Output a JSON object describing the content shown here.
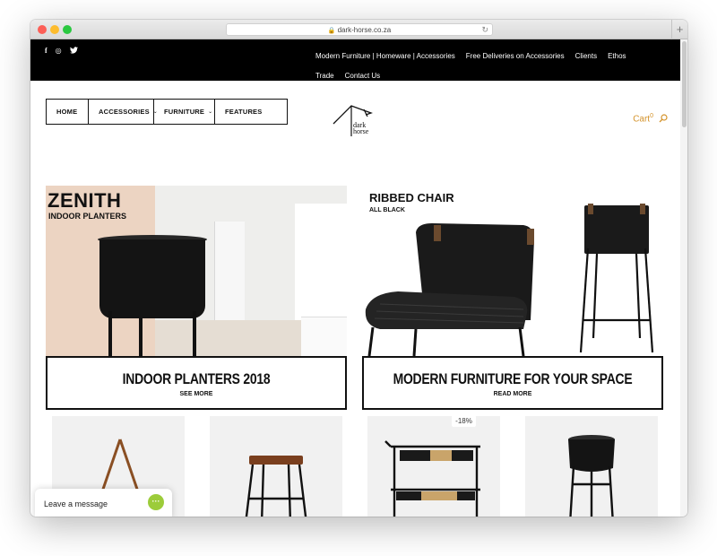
{
  "browser": {
    "url": "dark-horse.co.za"
  },
  "topbar": {
    "social_icons": [
      "facebook-icon",
      "instagram-icon",
      "twitter-icon"
    ],
    "social_glyphs": [
      "f",
      "◎",
      "✦"
    ],
    "nav_row1": [
      "Modern Furniture | Homeware | Accessories",
      "Free Deliveries on Accessories",
      "Clients",
      "Ethos"
    ],
    "nav_row2": [
      "Trade",
      "Contact Us"
    ]
  },
  "mainnav": {
    "items": [
      {
        "label": "HOME",
        "dropdown": false
      },
      {
        "label": "ACCESSORIES",
        "dropdown": true
      },
      {
        "label": "FURNITURE",
        "dropdown": true
      },
      {
        "label": "FEATURES",
        "dropdown": false
      }
    ],
    "logo_text": [
      "dark",
      "horse"
    ],
    "cart_label": "Cart",
    "cart_count": "0"
  },
  "banners": [
    {
      "title": "ZENITH",
      "subtitle": "INDOOR PLANTERS",
      "caption": "INDOOR PLANTERS 2018",
      "link": "SEE MORE"
    },
    {
      "title": "RIBBED CHAIR",
      "subtitle": "ALL BLACK",
      "caption": "MODERN FURNITURE FOR YOUR SPACE",
      "link": "READ MORE"
    }
  ],
  "products": {
    "sale_badge": "-18%"
  },
  "chat": {
    "label": "Leave a message"
  },
  "colors": {
    "accent": "#d4932b",
    "topbar_bg": "#000000",
    "chat_green": "#9ccc3a"
  }
}
